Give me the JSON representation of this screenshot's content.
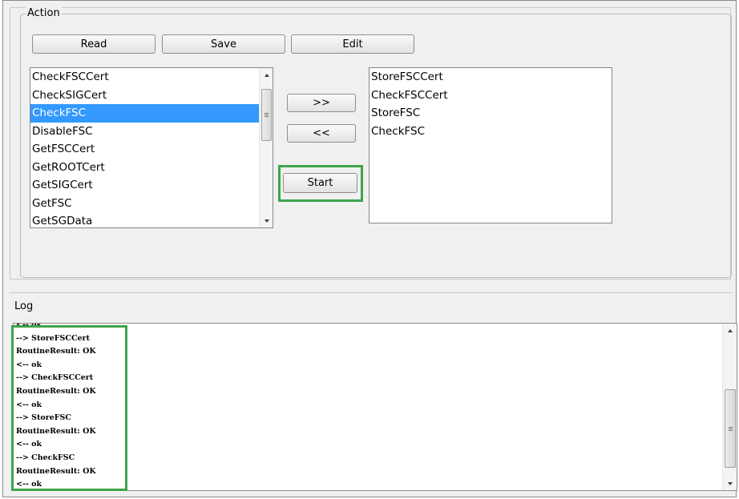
{
  "action": {
    "group_title": "Action",
    "buttons": {
      "read": "Read",
      "save": "Save",
      "edit": "Edit"
    },
    "available_list": {
      "items": [
        "CheckFSCCert",
        "CheckSIGCert",
        "CheckFSC",
        "DisableFSC",
        "GetFSCCert",
        "GetROOTCert",
        "GetSIGCert",
        "GetFSC",
        "GetSGData"
      ],
      "selected_index": 2
    },
    "move_buttons": {
      "add": ">>",
      "remove": "<<"
    },
    "start_label": "Start",
    "sequence_list": {
      "items": [
        "StoreFSCCert",
        "CheckFSCCert",
        "StoreFSC",
        "CheckFSC"
      ]
    }
  },
  "log": {
    "title": "Log",
    "lines": [
      "<-- ok",
      "--> StoreFSCCert",
      "RoutineResult: OK",
      "<-- ok",
      "--> CheckFSCCert",
      "RoutineResult: OK",
      "<-- ok",
      "--> StoreFSC",
      "RoutineResult: OK",
      "<-- ok",
      "--> CheckFSC",
      "RoutineResult: OK",
      "<-- ok"
    ]
  },
  "colors": {
    "selection": "#3399ff",
    "highlight": "#3fa34d"
  }
}
